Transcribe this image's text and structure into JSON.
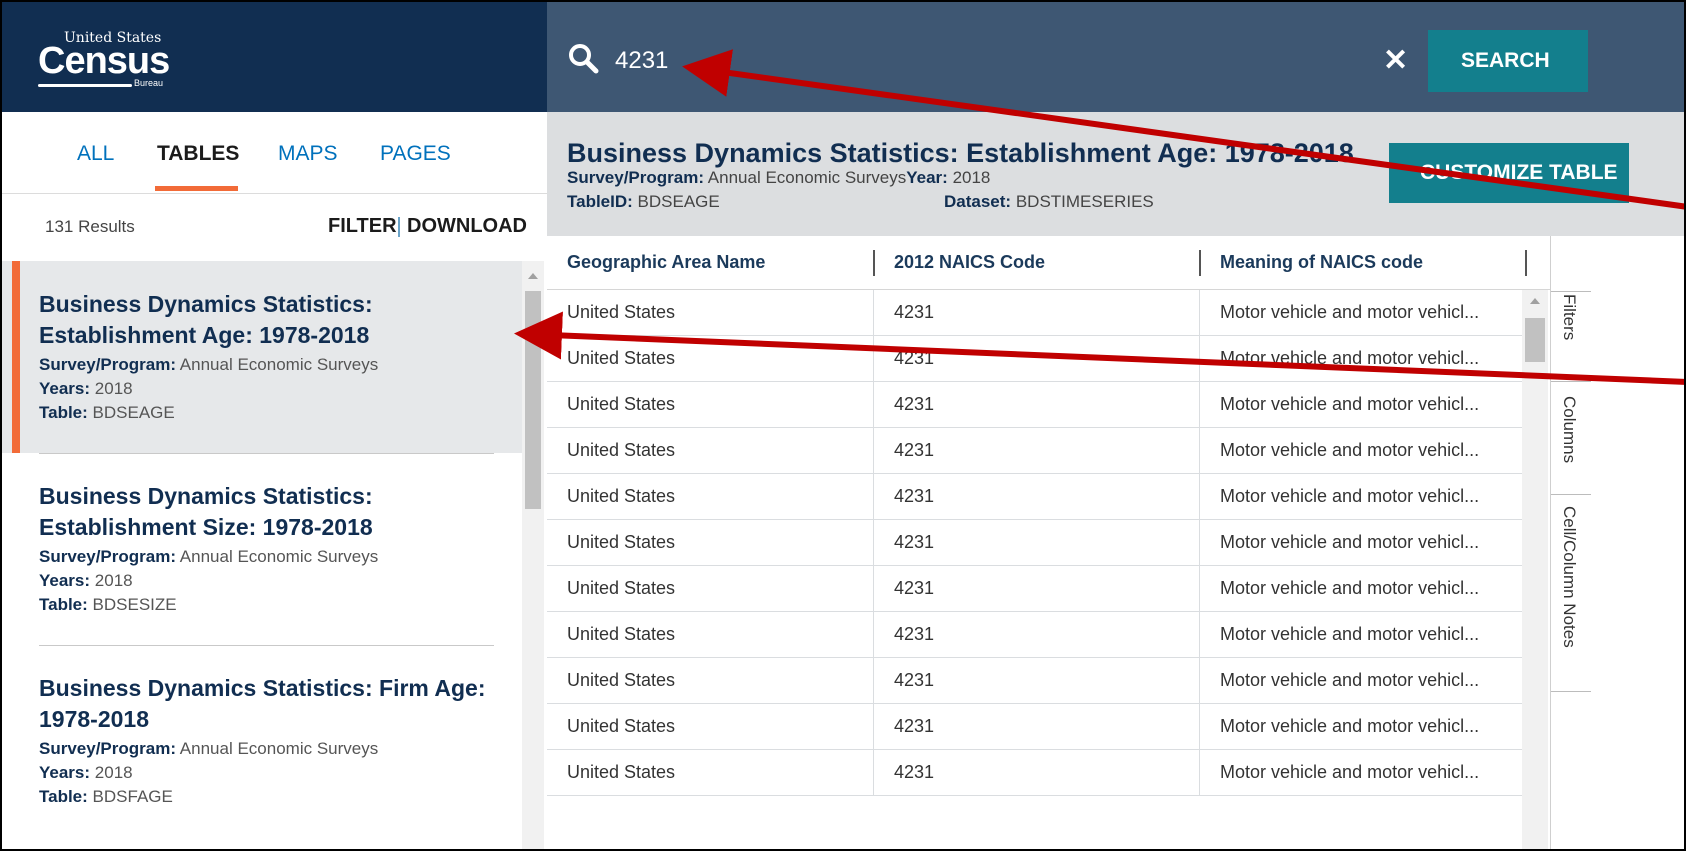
{
  "logo": {
    "top": "United States",
    "main": "Census",
    "sub": "Bureau",
    "tm": "™"
  },
  "tabs": [
    {
      "label": "ALL"
    },
    {
      "label": "TABLES"
    },
    {
      "label": "MAPS"
    },
    {
      "label": "PAGES"
    }
  ],
  "results": {
    "count": "131 Results",
    "filter": "FILTER",
    "download": "DOWNLOAD"
  },
  "items": [
    {
      "title": "Business Dynamics Statistics: Establishment Age: 1978-2018",
      "survey_label": "Survey/Program:",
      "survey": "Annual Economic Surveys",
      "years_label": "Years:",
      "years": "2018",
      "table_label": "Table:",
      "table": "BDSEAGE"
    },
    {
      "title": "Business Dynamics Statistics: Establishment Size: 1978-2018",
      "survey_label": "Survey/Program:",
      "survey": "Annual Economic Surveys",
      "years_label": "Years:",
      "years": "2018",
      "table_label": "Table:",
      "table": "BDSESIZE"
    },
    {
      "title": "Business Dynamics Statistics: Firm Age: 1978-2018",
      "survey_label": "Survey/Program:",
      "survey": "Annual Economic Surveys",
      "years_label": "Years:",
      "years": "2018",
      "table_label": "Table:",
      "table": "BDSFAGE"
    }
  ],
  "search": {
    "value": "4231",
    "button": "SEARCH",
    "clear_icon": "close-icon",
    "icon": "search-icon"
  },
  "table": {
    "title": "Business Dynamics Statistics: Establishment Age: 1978-2018",
    "survey_label": "Survey/Program:",
    "survey": "Annual Economic Surveys",
    "year_label": "Year:",
    "year": "2018",
    "tableid_label": "TableID:",
    "tableid": "BDSEAGE",
    "dataset_label": "Dataset:",
    "dataset": "BDSTIMESERIES",
    "customize": "CUSTOMIZE TABLE",
    "columns": [
      "Geographic Area Name",
      "2012 NAICS Code",
      "Meaning of NAICS code"
    ],
    "rows": [
      [
        "United States",
        "4231",
        "Motor vehicle and motor vehicl..."
      ],
      [
        "United States",
        "4231",
        "Motor vehicle and motor vehicl..."
      ],
      [
        "United States",
        "4231",
        "Motor vehicle and motor vehicl..."
      ],
      [
        "United States",
        "4231",
        "Motor vehicle and motor vehicl..."
      ],
      [
        "United States",
        "4231",
        "Motor vehicle and motor vehicl..."
      ],
      [
        "United States",
        "4231",
        "Motor vehicle and motor vehicl..."
      ],
      [
        "United States",
        "4231",
        "Motor vehicle and motor vehicl..."
      ],
      [
        "United States",
        "4231",
        "Motor vehicle and motor vehicl..."
      ],
      [
        "United States",
        "4231",
        "Motor vehicle and motor vehicl..."
      ],
      [
        "United States",
        "4231",
        "Motor vehicle and motor vehicl..."
      ],
      [
        "United States",
        "4231",
        "Motor vehicle and motor vehicl..."
      ]
    ]
  },
  "side_tabs": [
    "Filters",
    "Columns",
    "Cell/Column Notes"
  ],
  "colors": {
    "navy": "#112e51",
    "search_bar": "#3e5773",
    "teal": "#137f8d",
    "accent": "#f26b38",
    "link": "#0071bc",
    "arrow": "#c00000"
  }
}
